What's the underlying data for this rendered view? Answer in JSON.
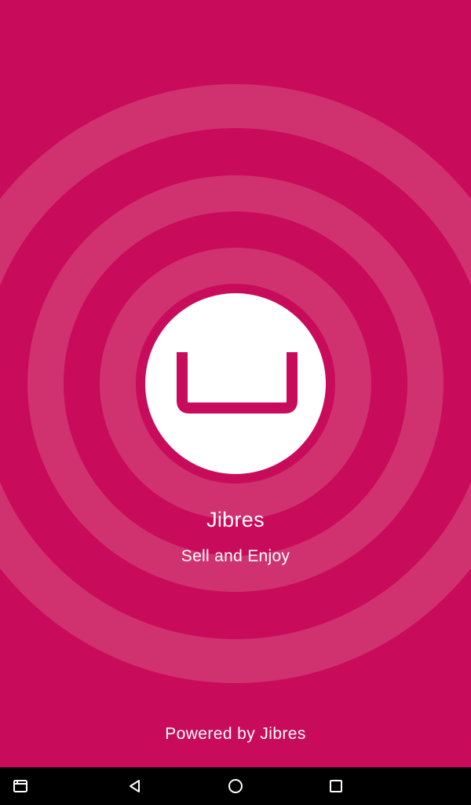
{
  "splash": {
    "app_name": "Jibres",
    "tagline": "Sell and Enjoy",
    "footer": "Powered by Jibres",
    "logo_icon": "shopping-basket-icon"
  },
  "colors": {
    "background": "#c80b5a",
    "ring": "#d0316f",
    "logo_background": "#ffffff",
    "text": "#ffffff",
    "navbar": "#000000"
  },
  "navbar": {
    "buttons": [
      "screenshot",
      "back",
      "home",
      "recents"
    ]
  }
}
